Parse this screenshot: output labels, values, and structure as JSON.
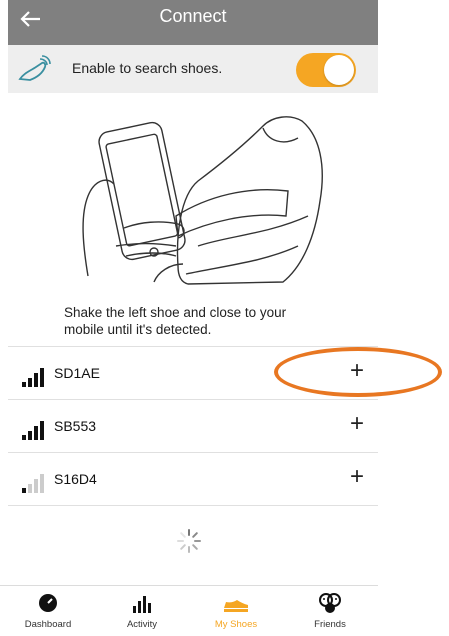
{
  "header": {
    "title": "Connect",
    "back_icon": "arrow-left-icon"
  },
  "enable": {
    "label": "Enable to search shoes.",
    "toggle_on": true,
    "icon": "shoe-signal-icon"
  },
  "instruction": "Shake the left shoe and close to your mobile until it's detected.",
  "devices": [
    {
      "name": "SD1AE",
      "signal": "strong",
      "action": "+"
    },
    {
      "name": "SB553",
      "signal": "strong",
      "action": "+"
    },
    {
      "name": "S16D4",
      "signal": "weak",
      "action": "+"
    }
  ],
  "tabs": [
    {
      "label": "Dashboard",
      "icon": "dashboard-icon"
    },
    {
      "label": "Activity",
      "icon": "activity-icon"
    },
    {
      "label": "My Shoes",
      "icon": "shoe-icon",
      "active": true
    },
    {
      "label": "Friends",
      "icon": "friends-icon"
    }
  ],
  "colors": {
    "accent": "#f5a623",
    "header": "#808080",
    "highlight": "#e87722"
  }
}
